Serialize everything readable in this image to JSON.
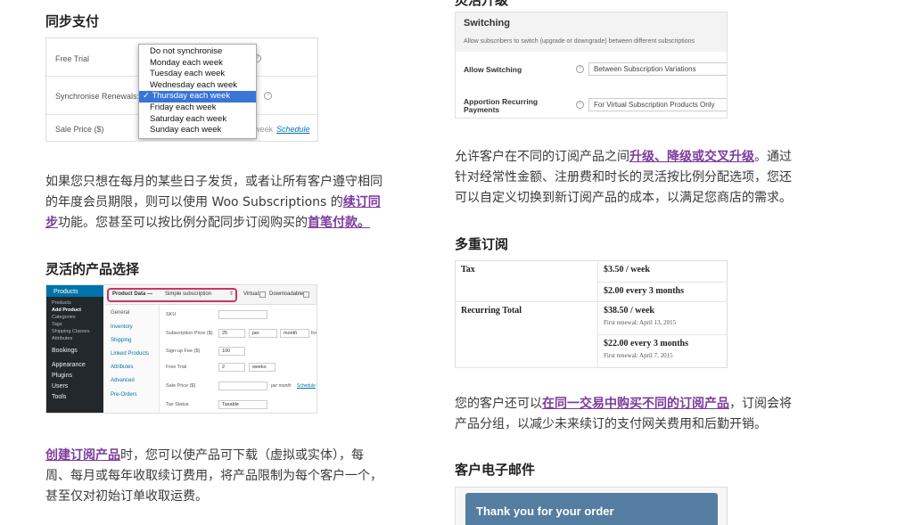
{
  "sync": {
    "heading": "同步支付",
    "fields": [
      "Free Trial",
      "Synchronise Renewals:",
      "Sale Price ($)"
    ],
    "suffix_week": "week",
    "schedule_link": "Schedule",
    "options": [
      "Do not synchronise",
      "Monday each week",
      "Tuesday each week",
      "Wednesday each week",
      "Thursday each week",
      "Friday each week",
      "Saturday each week",
      "Sunday each week"
    ],
    "selected": "Thursday each week",
    "para1": "如果您只想在每月的某些日子发货，或者让所有客户遵守相同",
    "para2": "的年度会员期限，则可以使用 Woo Subscriptions 的",
    "link1a": "续订同",
    "link1b": "步",
    "para3": "功能。您甚至可以按比例分配同步订阅购买的",
    "link2": "首笔付款。"
  },
  "flex": {
    "heading": "灵活的产品选择",
    "sidebar": {
      "products": "Products",
      "items": [
        "Products",
        "Add Product",
        "Categories",
        "Tags",
        "Shipping Classes",
        "Attributes"
      ],
      "bookings": "Bookings",
      "appearance": "Appearance",
      "plugins": "Plugins",
      "users": "Users",
      "tools": "Tools"
    },
    "product_data": "Product Data —",
    "product_type": "Simple subscription",
    "virtual": "Virtual:",
    "downloadable": "Downloadable:",
    "tabs": [
      "General",
      "Inventory",
      "Shipping",
      "Linked Products",
      "Attributes",
      "Advanced",
      "Pre-Orders"
    ],
    "labels": [
      "SKU",
      "Subscription Price ($)",
      "Sign-up Fee ($)",
      "Free Trial",
      "Sale Price ($)",
      "Tax Status"
    ],
    "price": "25",
    "per": "per",
    "period": "month",
    "for": "for",
    "signup": "100",
    "trial": "2",
    "trial_unit": "weeks",
    "per_month": "per month",
    "schedule": "Schedule",
    "tax": "Taxable",
    "link": "创建订阅产品",
    "para1": "时，您可以使产品可下载（虚拟或实体），每",
    "para2": "周、每月或每年收取续订费用，将产品限制为每个客户一个，",
    "para3": "甚至仅对初始订单收取运费。"
  },
  "switching": {
    "title": "Switching",
    "desc": "Allow subscribers to switch (upgrade or downgrade) between different subscriptions",
    "allow_label": "Allow Switching",
    "allow_value": "Between Subscription Variations",
    "apportion_label1": "Apportion Recurring",
    "apportion_label2": "Payments",
    "apportion_value": "For Virtual Subscription Products Only",
    "para1a": "允许客户在不同的订阅产品之间",
    "link": "升级、降级或交叉升级",
    "para1b": "。通过",
    "para2": "针对经常性金额、注册费和时长的灵活按比例分配选项，您还",
    "para3": "可以自定义切换到新订阅产品的成本，以满足您商店的需求。"
  },
  "multi": {
    "heading": "多重订阅",
    "tax_label": "Tax",
    "tax1": "$3.50 / week",
    "tax2": "$2.00 every 3 months",
    "rec_label": "Recurring Total",
    "rec1": "$38.50 / week",
    "rec1_sub": "First renewal: April 13, 2015",
    "rec2": "$22.00 every 3 months",
    "rec2_sub": "First renewal: April 7, 2015",
    "para1a": "您的客户还可以",
    "link": "在同一交易中购买不同的订阅产品",
    "para1b": "，订阅会将",
    "para2": "产品分组，以减少未来续订的支付网关费用和后勤开销。"
  },
  "email": {
    "heading": "客户电子邮件",
    "banner": "Thank you for your order"
  }
}
